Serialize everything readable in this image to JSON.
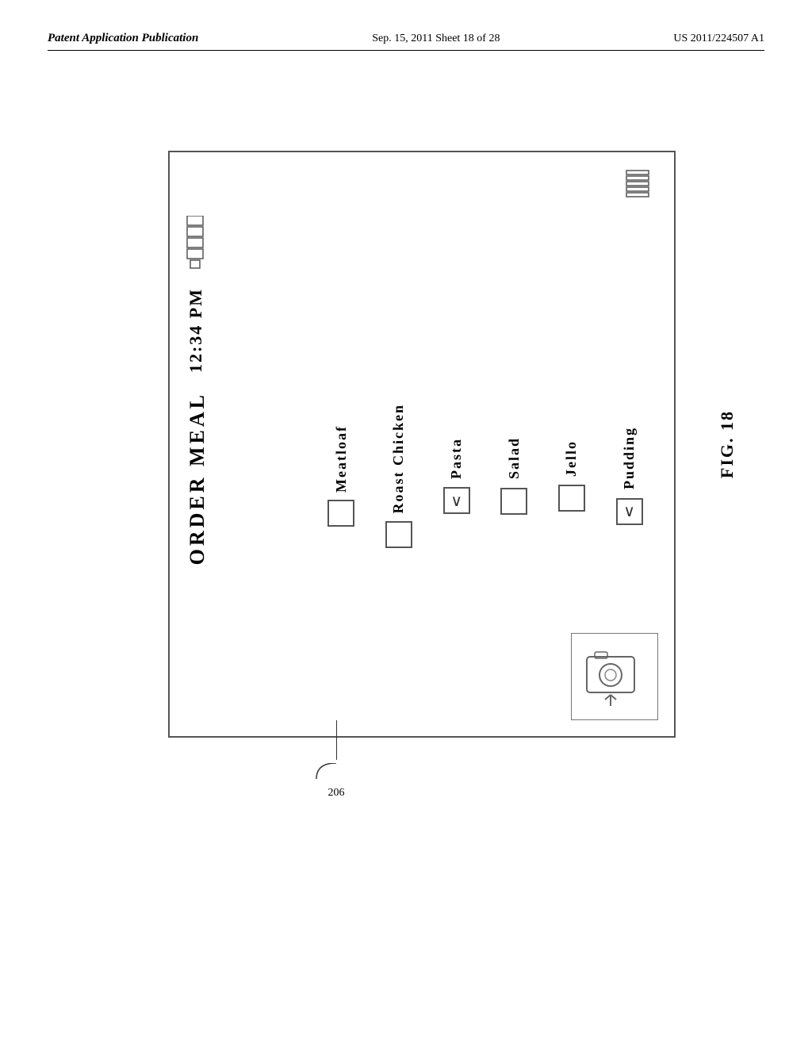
{
  "header": {
    "left": "Patent Application Publication",
    "center": "Sep. 15, 2011   Sheet 18 of 28",
    "right": "US 2011/224507 A1"
  },
  "fig": {
    "label": "FIG. 18",
    "ref": "206"
  },
  "screen": {
    "time": "12:34 PM",
    "orderMeal": "ORDER MEAL",
    "menuItems": [
      {
        "label": "Meatloaf",
        "checked": false
      },
      {
        "label": "Roast Chicken",
        "checked": false
      },
      {
        "label": "Pasta",
        "checked": true
      },
      {
        "label": "Salad",
        "checked": false
      },
      {
        "label": "Jello",
        "checked": false
      },
      {
        "label": "Pudding",
        "checked": true
      }
    ]
  }
}
